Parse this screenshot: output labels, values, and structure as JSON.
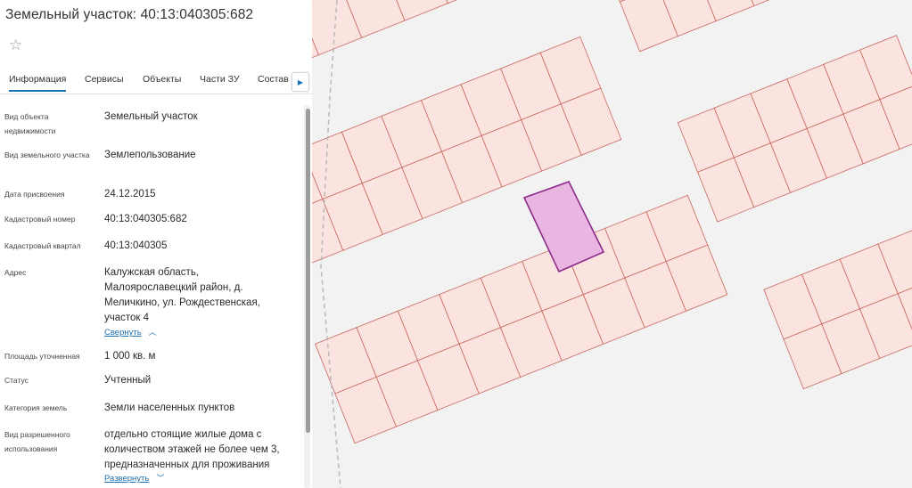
{
  "panel": {
    "title": "Земельный участок: 40:13:040305:682",
    "star_icon": "star-outline-icon",
    "tabs": [
      "Информация",
      "Сервисы",
      "Объекты",
      "Части ЗУ",
      "Состав"
    ],
    "active_tab": 0,
    "tab_scroll_icon": "chevron-right-icon",
    "fields": [
      {
        "label": "Вид объекта недвижимости",
        "value": "Земельный участок"
      },
      {
        "label": "Вид земельного участка",
        "value": "Землепользование"
      },
      {
        "label": "Дата присвоения",
        "value": "24.12.2015"
      },
      {
        "label": "Кадастровый номер",
        "value": "40:13:040305:682"
      },
      {
        "label": "Кадастровый квартал",
        "value": "40:13:040305"
      },
      {
        "label": "Адрес",
        "value": "Калужская область, Малоярославецкий район, д. Меличкино, ул. Рождественская, участок 4"
      },
      {
        "label": "Площадь уточненная",
        "value": "1 000 кв. м"
      },
      {
        "label": "Статус",
        "value": "Учтенный"
      },
      {
        "label": "Категория земель",
        "value": "Земли населенных пунктов"
      },
      {
        "label": "Вид разрешенного использования",
        "value": "отдельно стоящие жилые дома с количеством этажей не более чем 3, предназначенных для проживания"
      }
    ],
    "collapse_link": "Свернуть",
    "expand_link": "Развернуть"
  },
  "map": {
    "parcel_fill": "#fbe3df",
    "parcel_stroke": "#c8685e",
    "road_fill": "#f2f2f2",
    "selected_fill": "#e8b6e0",
    "selected_stroke": "#8d2a8c"
  }
}
